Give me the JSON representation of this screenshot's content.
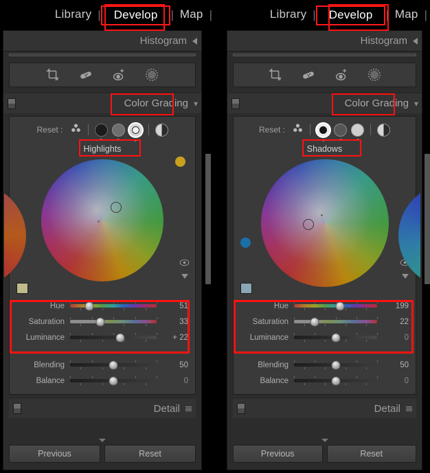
{
  "modules": {
    "items": [
      {
        "label": "Library",
        "active": false
      },
      {
        "label": "Develop",
        "active": true
      },
      {
        "label": "Map",
        "active": false
      }
    ],
    "separator": "|"
  },
  "histogram": {
    "title": "Histogram"
  },
  "toolbar": {
    "icons": [
      "crop-tool-icon",
      "spot-removal-icon",
      "red-eye-icon",
      "masking-icon"
    ]
  },
  "color_grading": {
    "title": "Color Grading",
    "reset_label": "Reset :",
    "wheel_tabs": [
      "all-wheels-icon",
      "shadows-wheel-icon",
      "midtones-wheel-icon",
      "highlights-wheel-icon",
      "global-wheel-icon"
    ]
  },
  "detail": {
    "title": "Detail"
  },
  "footer": {
    "previous_label": "Previous",
    "reset_label": "Reset"
  },
  "panels": [
    {
      "id": "left-panel",
      "active_tab": "Highlights",
      "selected_wheel_index": 3,
      "swatch_color": "#bfbb8a",
      "blob_color": "#c8a11f",
      "sliders": [
        {
          "name": "Hue",
          "value": "51",
          "pos": 22,
          "type": "hue",
          "dim": false
        },
        {
          "name": "Saturation",
          "value": "33",
          "pos": 35,
          "type": "sat",
          "dim": false
        },
        {
          "name": "Luminance",
          "value": "+ 22",
          "pos": 58,
          "type": "lum",
          "dim": false
        }
      ],
      "global_sliders": [
        {
          "name": "Blending",
          "value": "50",
          "pos": 50,
          "dim": false
        },
        {
          "name": "Balance",
          "value": "0",
          "pos": 50,
          "dim": true
        }
      ]
    },
    {
      "id": "right-panel",
      "active_tab": "Shadows",
      "selected_wheel_index": 1,
      "swatch_color": "#8ba6b4",
      "blob_color": "#1a6fa8",
      "sliders": [
        {
          "name": "Hue",
          "value": "199",
          "pos": 55,
          "type": "hue",
          "dim": false
        },
        {
          "name": "Saturation",
          "value": "22",
          "pos": 25,
          "type": "sat",
          "dim": false
        },
        {
          "name": "Luminance",
          "value": "0",
          "pos": 50,
          "type": "lum",
          "dim": true
        }
      ],
      "global_sliders": [
        {
          "name": "Blending",
          "value": "50",
          "pos": 50,
          "dim": false
        },
        {
          "name": "Balance",
          "value": "0",
          "pos": 50,
          "dim": true
        }
      ]
    }
  ]
}
